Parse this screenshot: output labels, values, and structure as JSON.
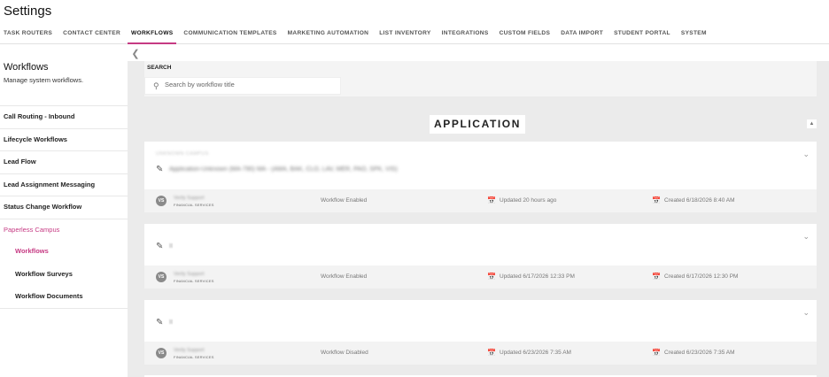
{
  "page": {
    "title": "Settings"
  },
  "tabs": [
    {
      "label": "TASK ROUTERS",
      "active": false
    },
    {
      "label": "CONTACT CENTER",
      "active": false
    },
    {
      "label": "WORKFLOWS",
      "active": true
    },
    {
      "label": "COMMUNICATION TEMPLATES",
      "active": false
    },
    {
      "label": "MARKETING AUTOMATION",
      "active": false
    },
    {
      "label": "LIST INVENTORY",
      "active": false
    },
    {
      "label": "INTEGRATIONS",
      "active": false
    },
    {
      "label": "CUSTOM FIELDS",
      "active": false
    },
    {
      "label": "DATA IMPORT",
      "active": false
    },
    {
      "label": "STUDENT PORTAL",
      "active": false
    },
    {
      "label": "SYSTEM",
      "active": false
    }
  ],
  "sidebar": {
    "title": "Workflows",
    "subtitle": "Manage system workflows.",
    "items": [
      {
        "label": "Call Routing - Inbound"
      },
      {
        "label": "Lifecycle Workflows"
      },
      {
        "label": "Lead Flow"
      },
      {
        "label": "Lead Assignment Messaging"
      },
      {
        "label": "Status Change Workflow"
      },
      {
        "label": "Paperless Campus"
      },
      {
        "label": "Workflows"
      },
      {
        "label": "Workflow Surveys"
      },
      {
        "label": "Workflow Documents"
      }
    ]
  },
  "search": {
    "label": "SEARCH",
    "placeholder": "Search by workflow title",
    "value": ""
  },
  "section": {
    "heading": "APPLICATION"
  },
  "colors": {
    "accent": "#c63a83",
    "background": "#ebebeb"
  },
  "icons": {
    "collapse": "chevron-left-icon",
    "edit": "pencil-icon",
    "expand": "chevron-down-icon",
    "calendar": "calendar-icon",
    "search": "search-icon"
  },
  "workflows": [
    {
      "campus": "UNKNOWN CAMPUS",
      "name": "Application-Unknown (MA-790) MA - (AMA, BAK, CLO, LAV, MER, PAO, SPK, VIS)",
      "owner_initials": "VS",
      "owner": "Verity Support",
      "department": "FINANCIAL SERVICES",
      "status": "Workflow Enabled",
      "updated": "Updated 20 hours ago",
      "created": "Created 6/18/2026 8:40 AM"
    },
    {
      "campus": "",
      "name": "II",
      "owner_initials": "VS",
      "owner": "Verity Support",
      "department": "FINANCIAL SERVICES",
      "status": "Workflow Enabled",
      "updated": "Updated 6/17/2026 12:33 PM",
      "created": "Created 6/17/2026 12:30 PM"
    },
    {
      "campus": "",
      "name": "II",
      "owner_initials": "VS",
      "owner": "Verity Support",
      "department": "FINANCIAL SERVICES",
      "status": "Workflow Disabled",
      "updated": "Updated 6/23/2026 7:35 AM",
      "created": "Created 6/23/2026 7:35 AM"
    }
  ]
}
